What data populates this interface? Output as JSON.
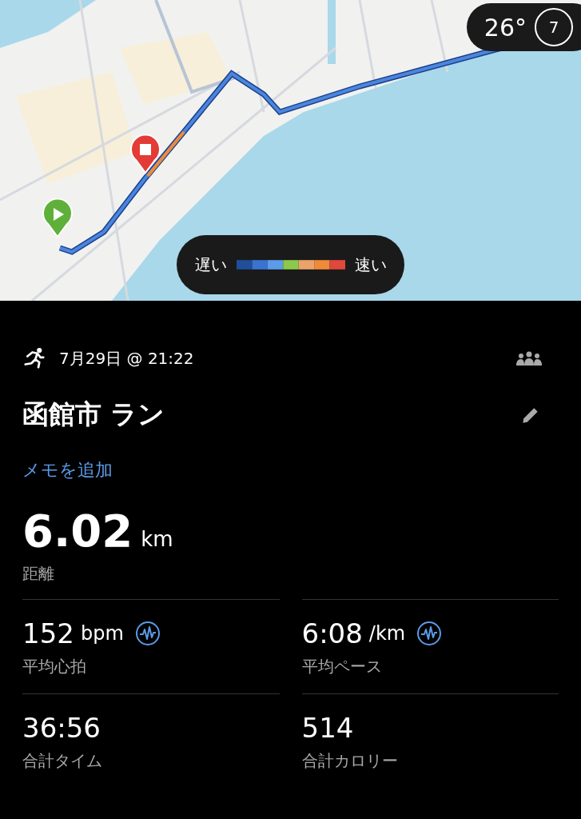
{
  "map": {
    "kind": "picture",
    "weather": {
      "temperature": "26°",
      "index": "7"
    },
    "legend": {
      "slow_label": "遅い",
      "fast_label": "速い"
    }
  },
  "activity": {
    "date": "7月29日 @ 21:22",
    "title": "函館市 ラン",
    "add_note": "メモを追加"
  },
  "distance": {
    "value": "6.02",
    "unit": "km",
    "label": "距離"
  },
  "metrics": [
    {
      "value": "152",
      "unit": "bpm",
      "label": "平均心拍",
      "chart_link": true
    },
    {
      "value": "6:08",
      "unit": "/km",
      "label": "平均ペース",
      "chart_link": true
    },
    {
      "value": "36:56",
      "label": "合計タイム",
      "chart_link": false
    },
    {
      "value": "514",
      "label": "合計カロリー",
      "chart_link": false
    }
  ]
}
